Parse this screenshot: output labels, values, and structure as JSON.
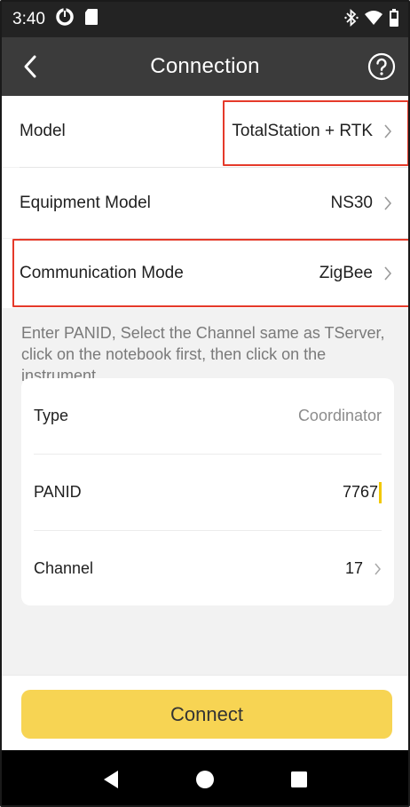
{
  "status_bar": {
    "time": "3:40",
    "icons": [
      "data-saver-icon",
      "sd-card-icon",
      "bluetooth-icon",
      "wifi-icon",
      "battery-icon"
    ]
  },
  "app_bar": {
    "title": "Connection",
    "back_icon": "chevron-left-icon",
    "help_icon": "help-circle-icon"
  },
  "settings": {
    "model": {
      "label": "Model",
      "value": "TotalStation + RTK"
    },
    "equipment_model": {
      "label": "Equipment Model",
      "value": "NS30"
    },
    "communication_mode": {
      "label": "Communication Mode",
      "value": "ZigBee"
    }
  },
  "hint": "Enter PANID, Select the Channel same as TServer, click on the notebook first, then click on the instrument",
  "zigbee": {
    "type": {
      "label": "Type",
      "value": "Coordinator"
    },
    "panid": {
      "label": "PANID",
      "value": "7767"
    },
    "channel": {
      "label": "Channel",
      "value": "17"
    }
  },
  "connect_label": "Connect",
  "colors": {
    "accent": "#f7d453",
    "highlight": "#e53a2a",
    "app_bar": "#3b3b3b",
    "status_bar": "#232323",
    "caret": "#f2c800"
  }
}
